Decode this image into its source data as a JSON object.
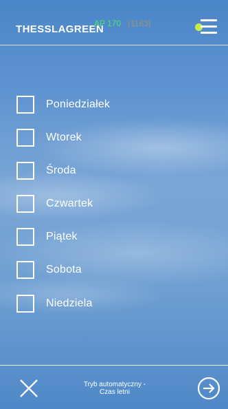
{
  "header": {
    "brand": "THESSLAGREEN",
    "model": "AP 170",
    "serial": "(1163)",
    "status_dot_color": "#c7ec4a",
    "menu_icon": "hamburger-menu-icon"
  },
  "days": [
    {
      "label": "Poniedziałek",
      "checked": false
    },
    {
      "label": "Wtorek",
      "checked": false
    },
    {
      "label": "Środa",
      "checked": false
    },
    {
      "label": "Czwartek",
      "checked": false
    },
    {
      "label": "Piątek",
      "checked": false
    },
    {
      "label": "Sobota",
      "checked": false
    },
    {
      "label": "Niedziela",
      "checked": false
    }
  ],
  "footer": {
    "mode_line1": "Tryb automatyczny -",
    "mode_line2": "Czas letni",
    "close_icon": "close-icon",
    "next_icon": "arrow-right-circle-icon"
  }
}
